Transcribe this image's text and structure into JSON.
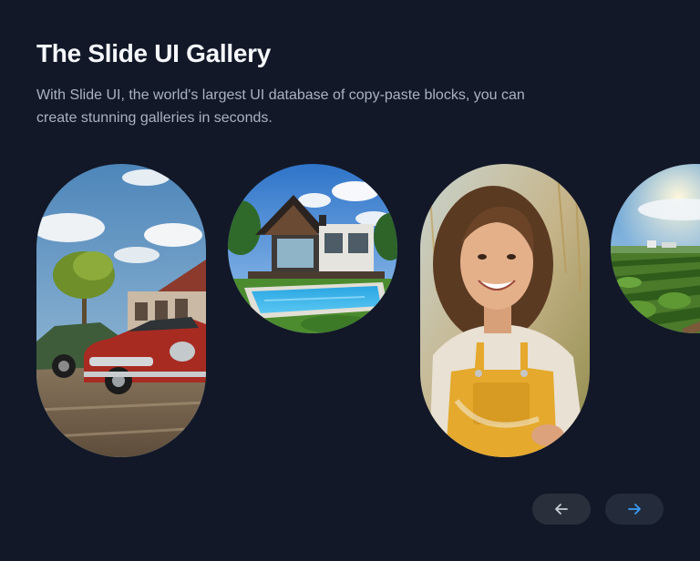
{
  "header": {
    "title": "The Slide UI Gallery",
    "description": "With Slide UI, the world's largest UI database of copy-paste blocks, you can create stunning galleries in seconds."
  },
  "gallery": {
    "slides": [
      {
        "subject": "classic-cars"
      },
      {
        "subject": "modern-house-pool"
      },
      {
        "subject": "smiling-woman-overalls"
      },
      {
        "subject": "farm-field"
      }
    ]
  },
  "navigation": {
    "prev_icon": "arrow-left-icon",
    "next_icon": "arrow-right-icon",
    "prev_color": "#c9ced6",
    "next_color": "#3b9cf6"
  },
  "colors": {
    "background": "#121827",
    "title": "#f5f7fa",
    "description": "#aab2c0"
  }
}
